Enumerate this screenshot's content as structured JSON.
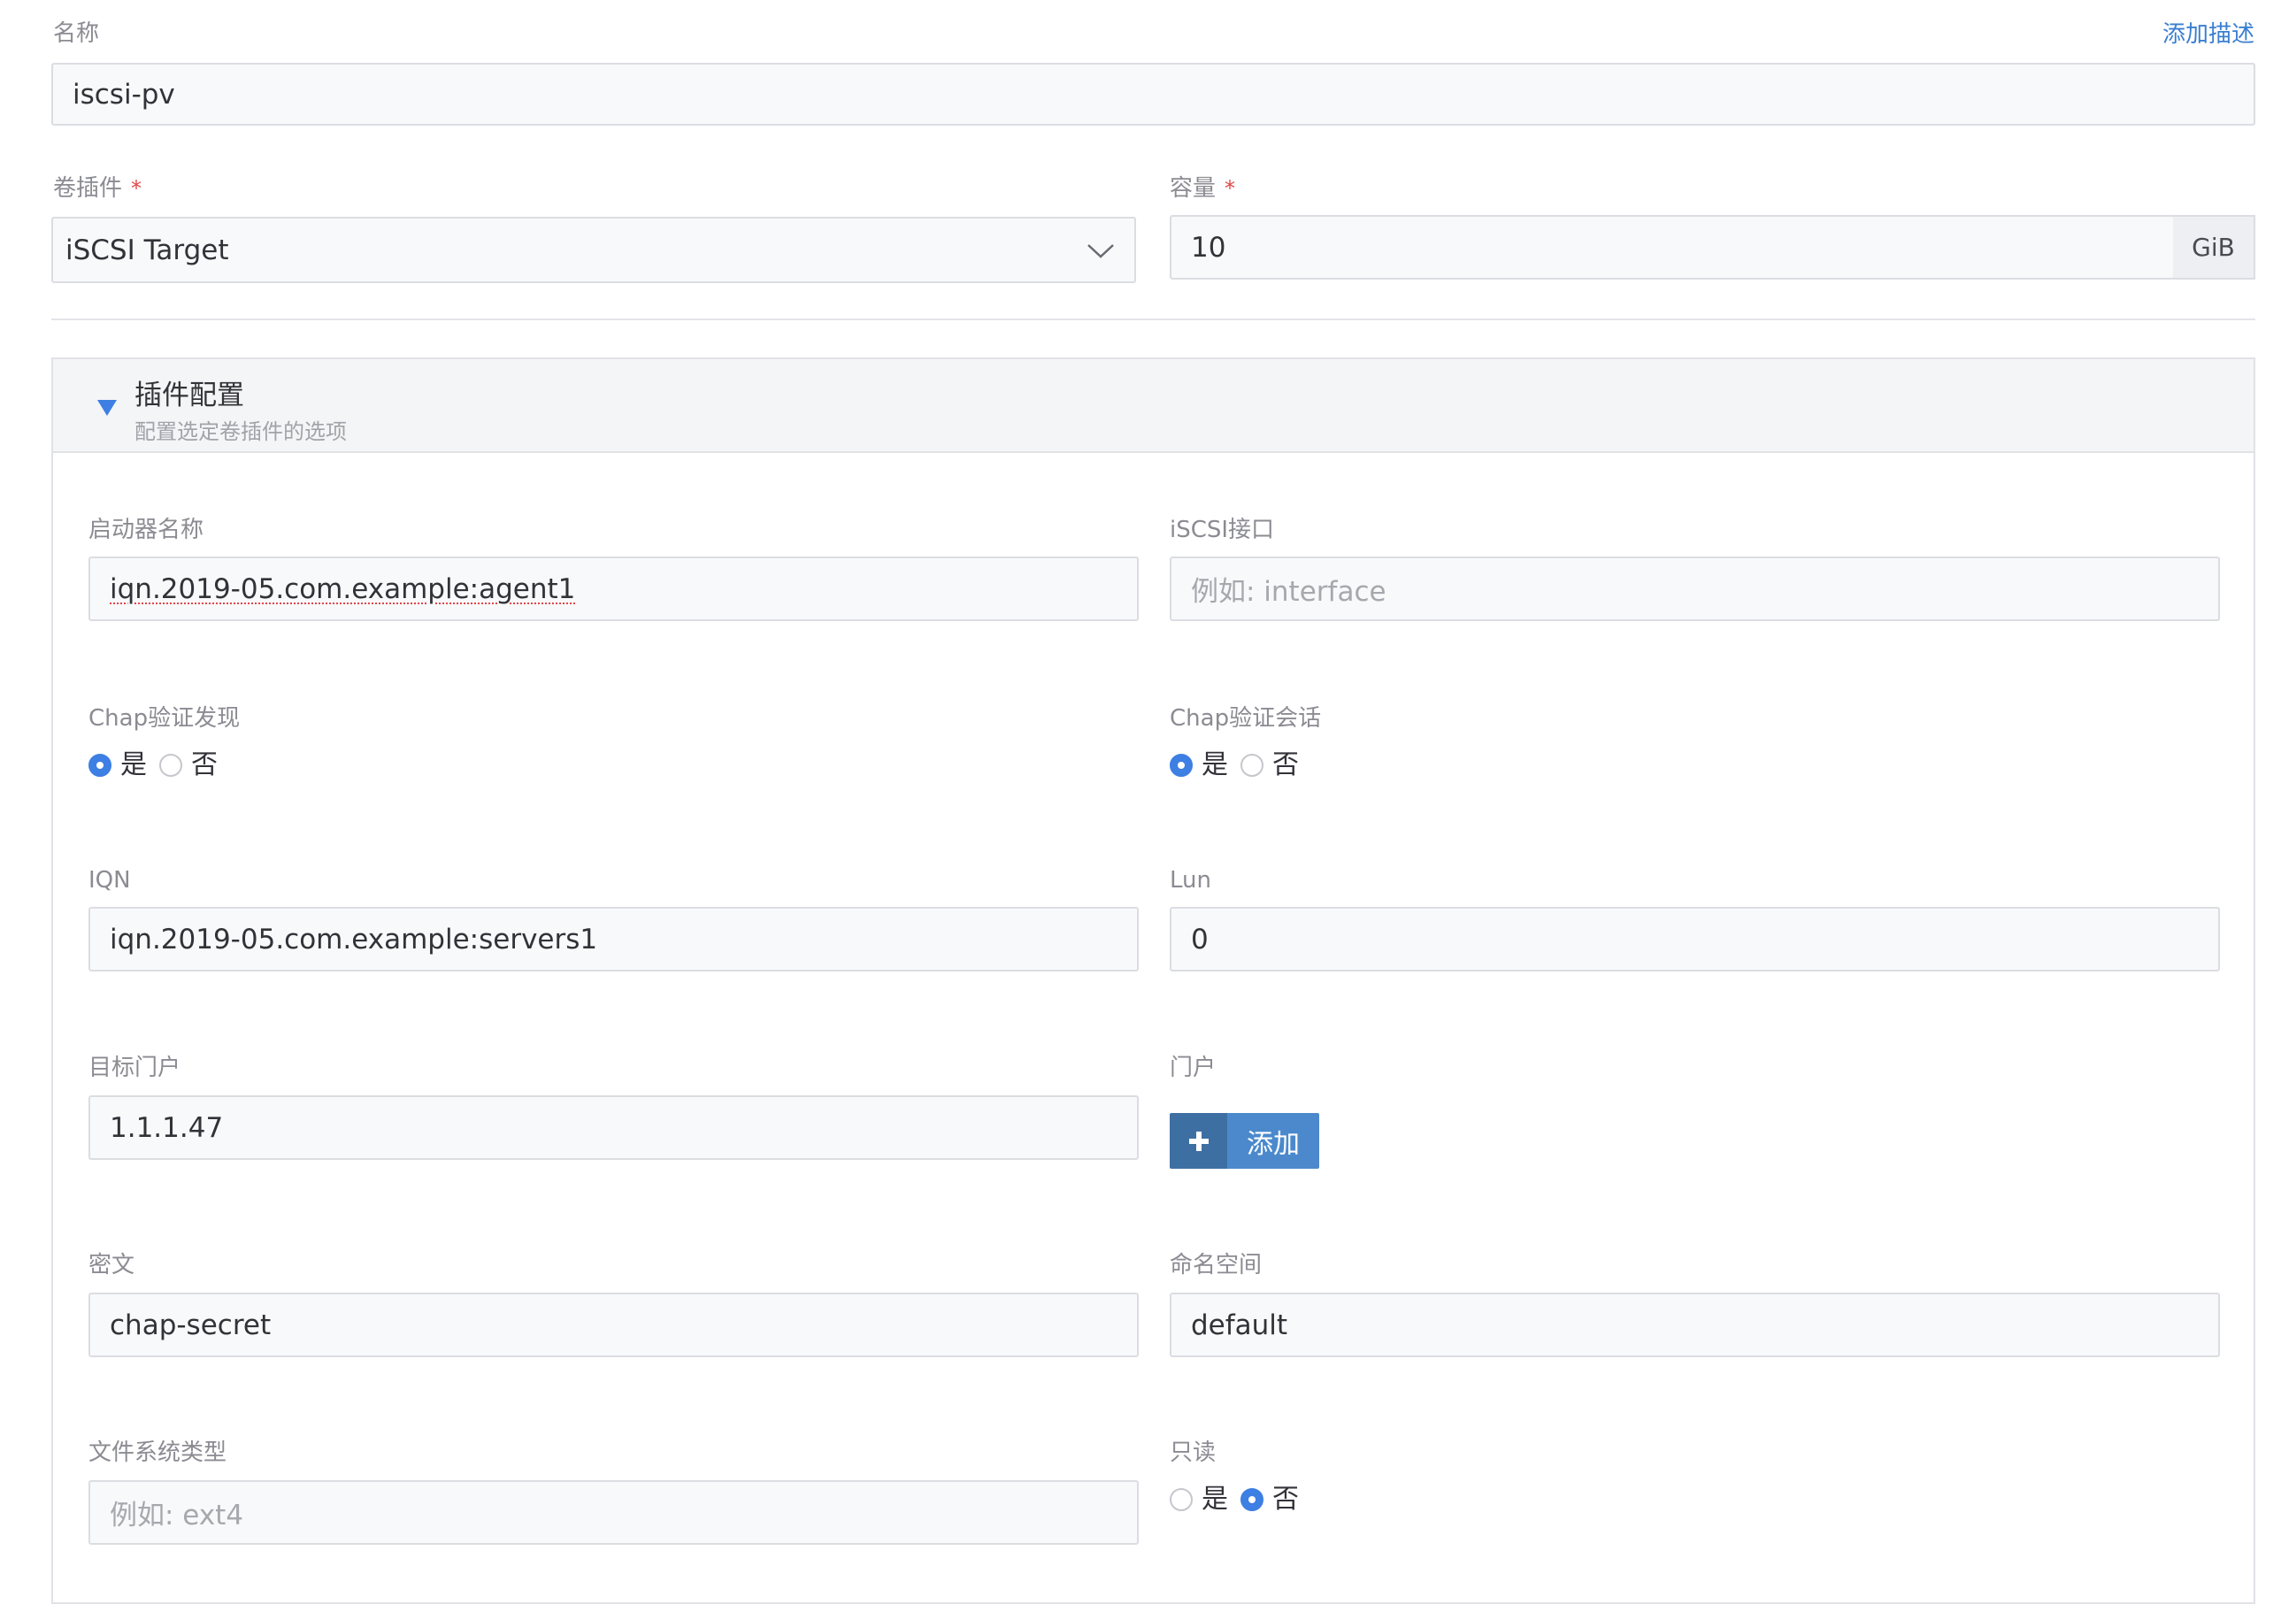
{
  "form": {
    "name": {
      "label": "名称",
      "value": "iscsi-pv",
      "add_description": "添加描述"
    },
    "volume_plugin": {
      "label": "卷插件",
      "required_mark": "*",
      "value": "iSCSI Target"
    },
    "capacity": {
      "label": "容量",
      "required_mark": "*",
      "value": "10",
      "unit": "GiB"
    }
  },
  "plugin_config": {
    "title": "插件配置",
    "subtitle": "配置选定卷插件的选项",
    "initiator_name": {
      "label": "启动器名称",
      "value": "iqn.2019-05.com.example:agent1"
    },
    "iscsi_interface": {
      "label": "iSCSI接口",
      "placeholder": "例如: interface"
    },
    "chap_discovery": {
      "label": "Chap验证发现",
      "yes": "是",
      "no": "否",
      "selected": "yes"
    },
    "chap_session": {
      "label": "Chap验证会话",
      "yes": "是",
      "no": "否",
      "selected": "yes"
    },
    "iqn": {
      "label": "IQN",
      "value": "iqn.2019-05.com.example:servers1"
    },
    "lun": {
      "label": "Lun",
      "value": "0"
    },
    "target_portal": {
      "label": "目标门户",
      "value": "1.1.1.47"
    },
    "portals": {
      "label": "门户",
      "add_button": "添加"
    },
    "secret": {
      "label": "密文",
      "value": "chap-secret"
    },
    "namespace": {
      "label": "命名空间",
      "value": "default"
    },
    "fs_type": {
      "label": "文件系统类型",
      "placeholder": "例如: ext4"
    },
    "read_only": {
      "label": "只读",
      "yes": "是",
      "no": "否",
      "selected": "no"
    }
  },
  "colors": {
    "accent": "#3d7fe3",
    "link": "#3a7fd0",
    "button_icon_bg": "#3e6fa3",
    "button_bg": "#4b89cc",
    "required": "#e04848"
  }
}
